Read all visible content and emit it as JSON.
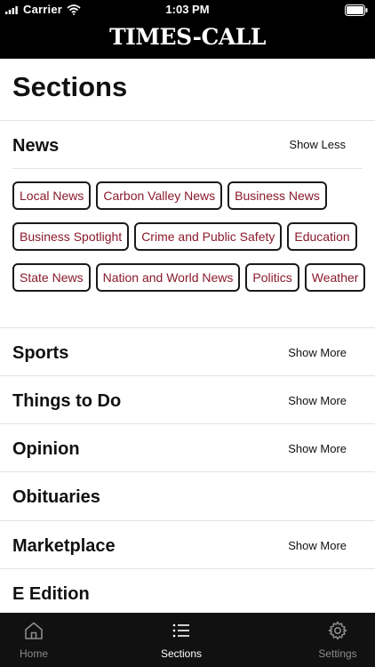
{
  "status_bar": {
    "carrier": "Carrier",
    "time": "1:03 PM"
  },
  "masthead": "TIMES-CALL",
  "page_title": "Sections",
  "news": {
    "title": "News",
    "toggle": "Show Less",
    "chips": [
      "Local News",
      "Carbon Valley News",
      "Business News",
      "Business Spotlight",
      "Crime and Public Safety",
      "Education",
      "State News",
      "Nation and World News",
      "Politics",
      "Weather"
    ]
  },
  "sections": [
    {
      "title": "Sports",
      "toggle": "Show More"
    },
    {
      "title": "Things to Do",
      "toggle": "Show More"
    },
    {
      "title": "Opinion",
      "toggle": "Show More"
    },
    {
      "title": "Obituaries",
      "toggle": ""
    },
    {
      "title": "Marketplace",
      "toggle": "Show More"
    },
    {
      "title": "E Edition",
      "toggle": ""
    }
  ],
  "tabs": [
    {
      "label": "Home",
      "icon": "home-icon",
      "active": false
    },
    {
      "label": "Sections",
      "icon": "list-icon",
      "active": true
    },
    {
      "label": "Settings",
      "icon": "gear-icon",
      "active": false
    }
  ],
  "colors": {
    "header_bg": "#000000",
    "chip_text": "#8a1a2b",
    "tab_active": "#ffffff",
    "tab_inactive": "#8c8c8c"
  }
}
